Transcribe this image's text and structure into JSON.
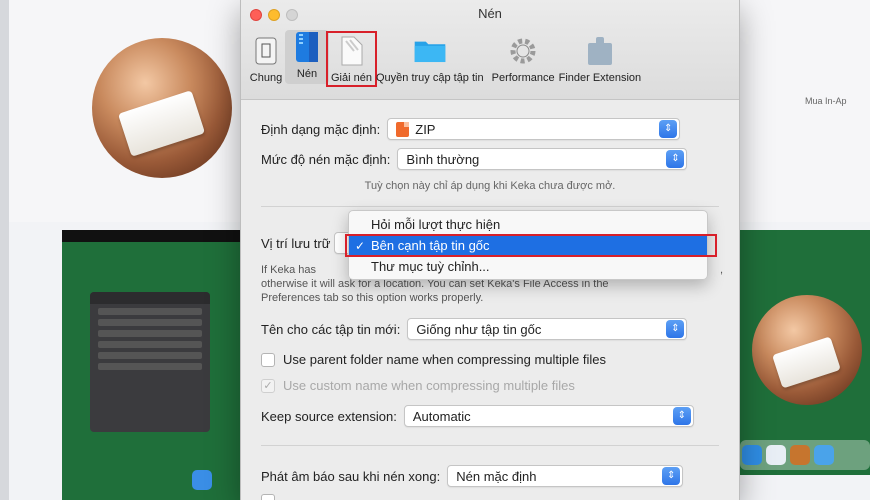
{
  "window": {
    "title": "Nén"
  },
  "background": {
    "purchase_text": "Mua In-Ap"
  },
  "toolbar": [
    {
      "label": "Chung",
      "icon": "phone-switch-icon"
    },
    {
      "label": "Nén",
      "icon": "compress-file-icon"
    },
    {
      "label": "Giải nén",
      "icon": "extract-file-icon"
    },
    {
      "label": "Quyền truy cập tập tin",
      "icon": "folder-icon"
    },
    {
      "label": "Performance",
      "icon": "gear-icon"
    },
    {
      "label": "Finder Extension",
      "icon": "extension-icon"
    }
  ],
  "settings": {
    "default_format_label": "Định dạng mặc định:",
    "default_format_value": "ZIP",
    "compression_level_label": "Mức độ nén mặc định:",
    "compression_level_value": "Bình thường",
    "hint": "Tuỳ chọn này chỉ áp dụng khi Keka chưa được mở.",
    "save_location_label": "Vị trí lưu trữ",
    "save_location_desc": "If Keka has permission to write to the source folder it will save there, otherwise it will ask for a location. You can set Keka's File Access in the Preferences tab so this option works properly.",
    "save_location_desc_visible_line1": "If Keka has",
    "save_location_desc_visible_line1_end": ",",
    "save_location_desc_visible_line2": "otherwise it will ask for a location. You can set Keka's File Access in the",
    "save_location_desc_visible_line3": "Preferences tab so this option works properly.",
    "new_name_label": "Tên cho các tập tin mới:",
    "new_name_value": "Giống như tập tin gốc",
    "use_parent_label": "Use parent folder name when compressing multiple files",
    "use_custom_label": "Use custom name when compressing multiple files",
    "keep_ext_label": "Keep source extension:",
    "keep_ext_value": "Automatic",
    "sound_label": "Phát âm báo sau khi nén xong:",
    "sound_value": "Nén mặc định"
  },
  "menu": {
    "items": [
      "Hỏi mỗi lượt thực hiện",
      "Bên cạnh tập tin gốc",
      "Thư mục tuỳ chỉnh..."
    ],
    "selected_index": 1
  },
  "colors": {
    "accent": "#1e6fe3",
    "highlight": "#d8202a"
  }
}
